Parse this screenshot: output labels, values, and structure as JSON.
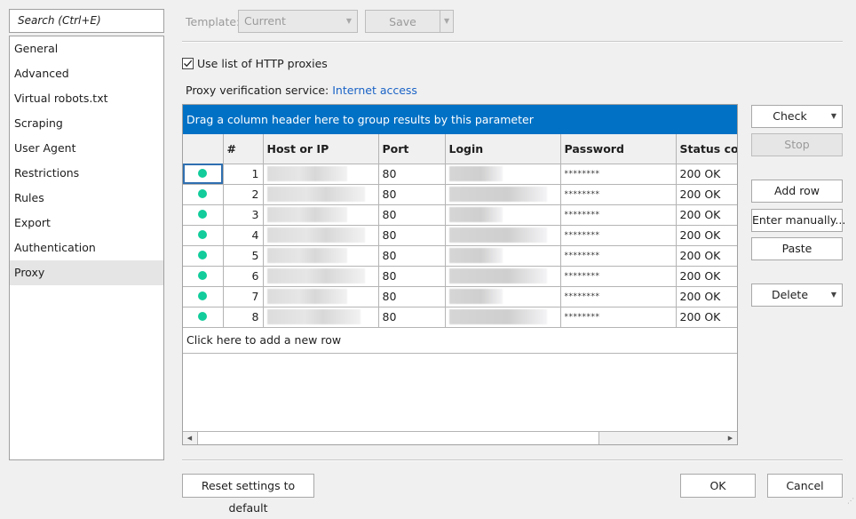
{
  "sidebar": {
    "search_placeholder": "Search (Ctrl+E)",
    "items": [
      {
        "label": "General",
        "selected": false
      },
      {
        "label": "Advanced",
        "selected": false
      },
      {
        "label": "Virtual robots.txt",
        "selected": false
      },
      {
        "label": "Scraping",
        "selected": false
      },
      {
        "label": "User Agent",
        "selected": false
      },
      {
        "label": "Restrictions",
        "selected": false
      },
      {
        "label": "Rules",
        "selected": false
      },
      {
        "label": "Export",
        "selected": false
      },
      {
        "label": "Authentication",
        "selected": false
      },
      {
        "label": "Proxy",
        "selected": true
      }
    ]
  },
  "toolbar": {
    "template_label": "Template:",
    "template_value": "Current",
    "save_label": "Save"
  },
  "proxy": {
    "use_list_label": "Use list of HTTP proxies",
    "use_list_checked": true,
    "verification_label": "Proxy verification service:",
    "verification_link": "Internet access"
  },
  "grid": {
    "group_hint": "Drag a column header here to group results by this parameter",
    "columns": [
      "",
      "#",
      "Host or IP",
      "Port",
      "Login",
      "Password",
      "Status code"
    ],
    "rows": [
      {
        "num": "1",
        "host": "[redacted]",
        "port": "80",
        "login": "[redacted]",
        "password": "********",
        "status": "200 OK",
        "status_color": "#12cc9b"
      },
      {
        "num": "2",
        "host": "[redacted]",
        "port": "80",
        "login": "[redacted]",
        "password": "********",
        "status": "200 OK",
        "status_color": "#12cc9b"
      },
      {
        "num": "3",
        "host": "[redacted]",
        "port": "80",
        "login": "[redacted]",
        "password": "********",
        "status": "200 OK",
        "status_color": "#12cc9b"
      },
      {
        "num": "4",
        "host": "[redacted]",
        "port": "80",
        "login": "[redacted]",
        "password": "********",
        "status": "200 OK",
        "status_color": "#12cc9b"
      },
      {
        "num": "5",
        "host": "[redacted]",
        "port": "80",
        "login": "[redacted]",
        "password": "********",
        "status": "200 OK",
        "status_color": "#12cc9b"
      },
      {
        "num": "6",
        "host": "[redacted]",
        "port": "80",
        "login": "[redacted]",
        "password": "********",
        "status": "200 OK",
        "status_color": "#12cc9b"
      },
      {
        "num": "7",
        "host": "[redacted]",
        "port": "80",
        "login": "[redacted]",
        "password": "********",
        "status": "200 OK",
        "status_color": "#12cc9b"
      },
      {
        "num": "8",
        "host": "[redacted]",
        "port": "80",
        "login": "[redacted]",
        "password": "********",
        "status": "200 OK",
        "status_color": "#12cc9b"
      }
    ],
    "add_row_hint": "Click here to add a new row"
  },
  "actions": {
    "check": "Check",
    "stop": "Stop",
    "add_row": "Add row",
    "enter_manually": "Enter manually...",
    "paste": "Paste",
    "delete": "Delete"
  },
  "footer": {
    "reset": "Reset settings to default",
    "ok": "OK",
    "cancel": "Cancel"
  },
  "colors": {
    "accent": "#0071c5",
    "link": "#1a63c6",
    "status_ok": "#12cc9b"
  }
}
